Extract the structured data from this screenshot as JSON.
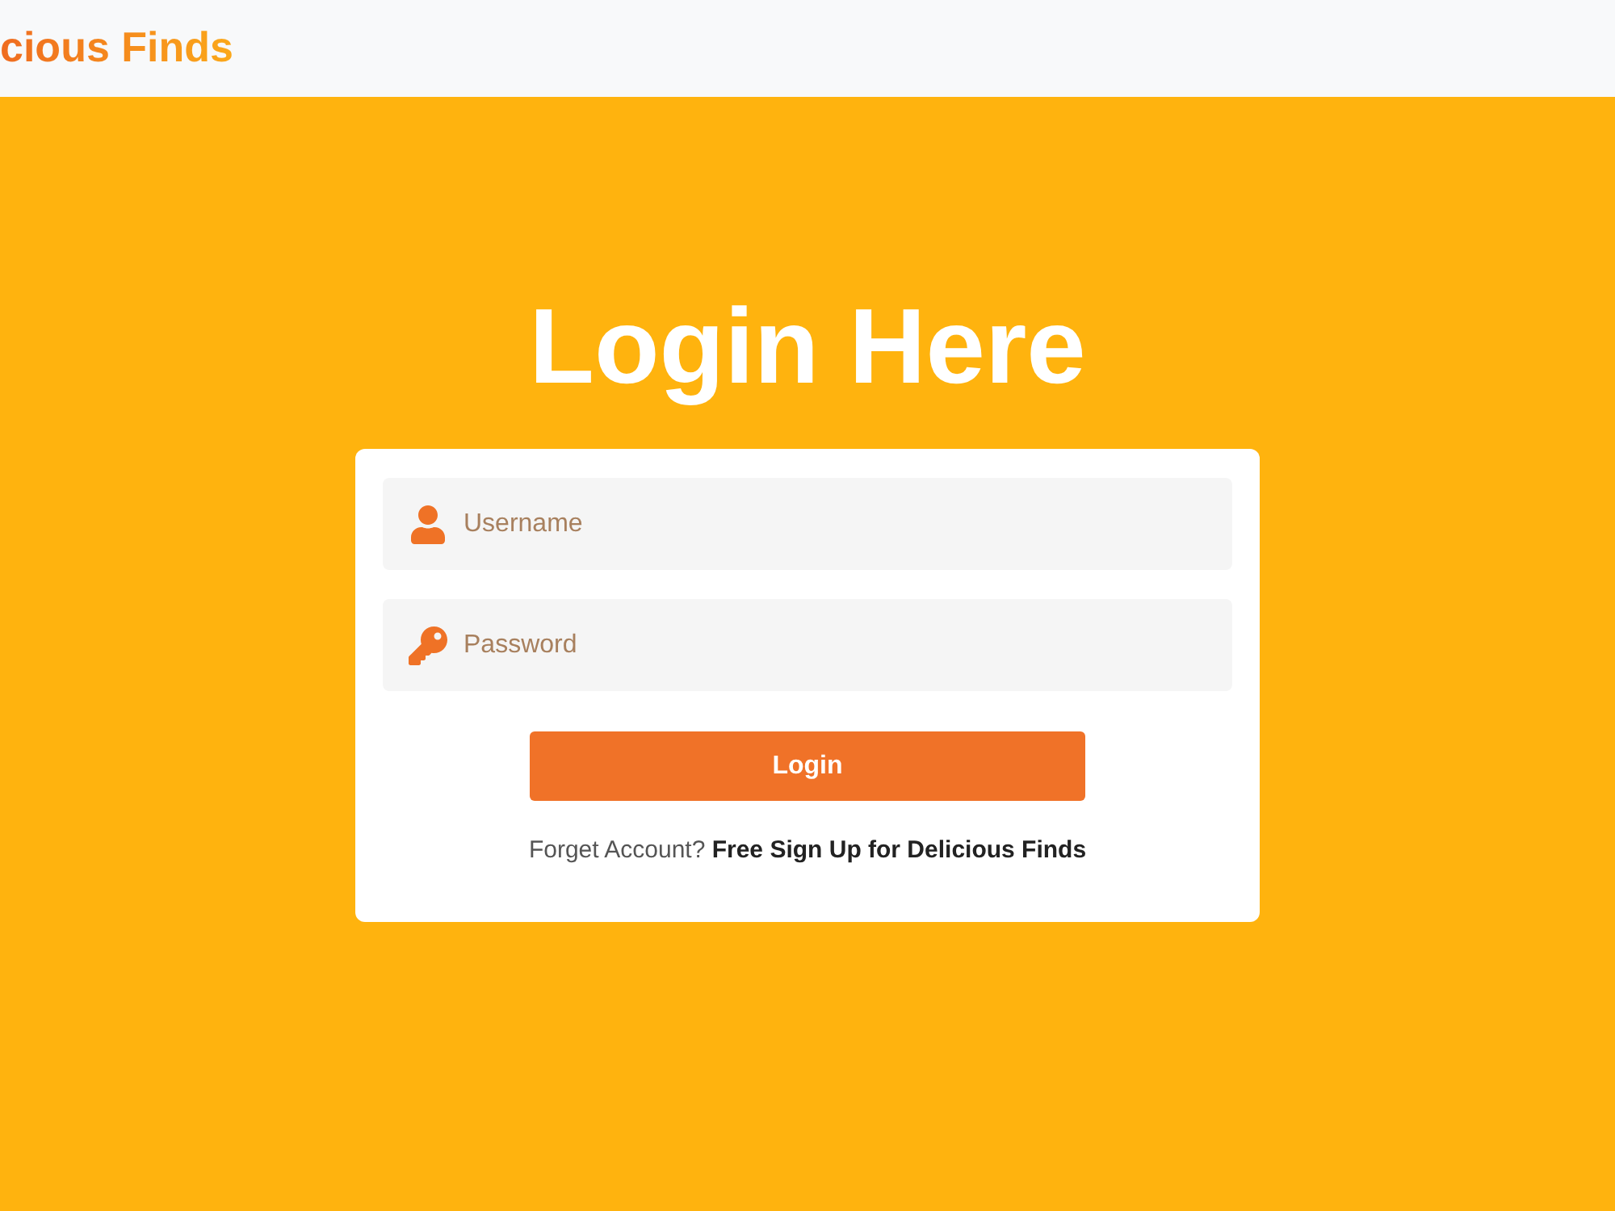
{
  "header": {
    "logo": "cious Finds"
  },
  "page": {
    "title": "Login Here"
  },
  "form": {
    "fields": [
      {
        "kind": "user",
        "placeholder": "Username"
      },
      {
        "kind": "password",
        "placeholder": "Password"
      }
    ],
    "submit": "Login",
    "footer": {
      "text": "Forget Account?",
      "link": "Free Sign Up for Delicious Finds"
    }
  }
}
